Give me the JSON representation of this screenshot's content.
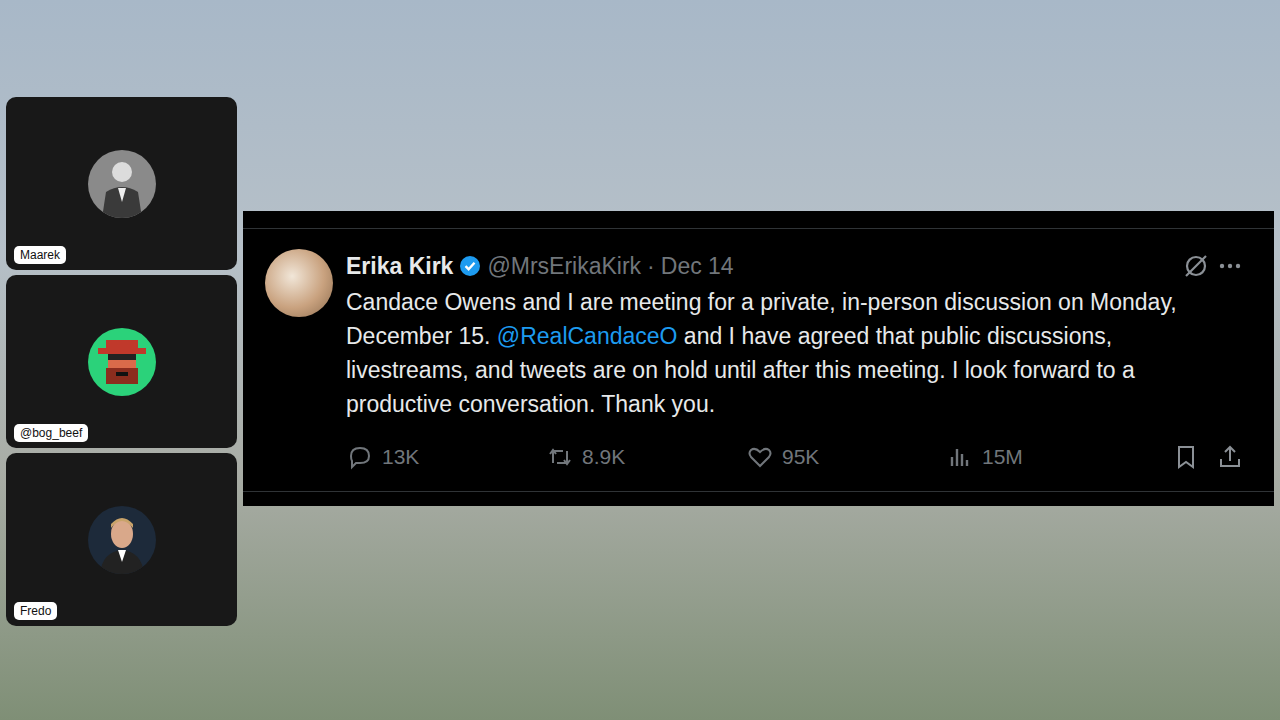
{
  "participants": [
    {
      "name": "Maarek",
      "avatar": "gray"
    },
    {
      "name": "@bog_beef",
      "avatar": "green"
    },
    {
      "name": "Fredo",
      "avatar": "dark"
    }
  ],
  "tweet": {
    "author": "Erika Kirk",
    "verified": true,
    "handle": "@MrsErikaKirk",
    "separator": "·",
    "date": "Dec 14",
    "text_before": "Candace Owens and I are meeting for a private, in-person discussion on Monday, December 15. ",
    "mention": "@RealCandaceO",
    "text_after": " and I have agreed that public discussions, livestreams, and tweets are on hold until after this meeting. I look forward to a productive conversation. Thank you.",
    "stats": {
      "replies": "13K",
      "retweets": "8.9K",
      "likes": "95K",
      "views": "15M"
    }
  }
}
